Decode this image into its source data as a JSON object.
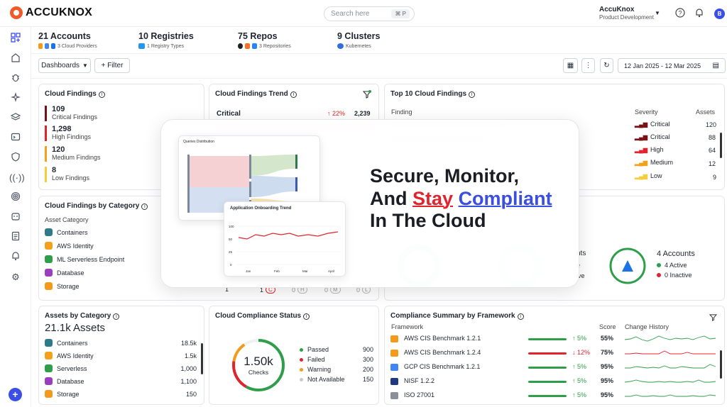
{
  "brand": {
    "name": "ACCUKNOX"
  },
  "search": {
    "placeholder": "Search here",
    "shortcut": "⌘ P"
  },
  "account": {
    "name": "AccuKnox",
    "workspace": "Product Development",
    "avatar_initial": "B"
  },
  "summary": {
    "accounts": {
      "title": "21 Accounts",
      "sub": "3 Cloud Providers"
    },
    "registries": {
      "title": "10 Registries",
      "sub": "1 Registry Types"
    },
    "repos": {
      "title": "75 Repos",
      "sub": "3 Repositories"
    },
    "clusters": {
      "title": "9 Clusters",
      "sub": "Kubernetes"
    }
  },
  "toolbar": {
    "dashboards_label": "Dashboards",
    "filter_label": "+ Filter",
    "date_range": "12 Jan 2025 - 12 Mar 2025"
  },
  "cloud_findings": {
    "title": "Cloud Findings",
    "rows": [
      {
        "value": "109",
        "label": "Critical Findings",
        "color": "#7a1016"
      },
      {
        "value": "1,298",
        "label": "High Findings",
        "color": "#e0242d"
      },
      {
        "value": "120",
        "label": "Medium Findings",
        "color": "#f2a11a"
      },
      {
        "value": "8",
        "label": "Low Findings",
        "color": "#f4cf3c"
      }
    ]
  },
  "trend": {
    "title": "Cloud Findings Trend",
    "row_label": "Critical",
    "change": "↑ 22%",
    "value": "2,239"
  },
  "top10": {
    "title": "Top 10 Cloud Findings",
    "col_finding": "Finding",
    "col_severity": "Severity",
    "col_assets": "Assets",
    "rows": [
      {
        "severity": "Critical",
        "assets": "120"
      },
      {
        "severity": "Critical",
        "assets": "88"
      },
      {
        "severity": "High",
        "assets": "64"
      },
      {
        "severity": "Medium",
        "assets": "12"
      },
      {
        "severity": "Low",
        "assets": "9"
      }
    ]
  },
  "by_category": {
    "title": "Cloud Findings by Category",
    "subtitle": "Asset Category",
    "items": [
      "Containers",
      "AWS Identity",
      "ML Serverless Endpoint",
      "Database",
      "Storage"
    ],
    "footer": {
      "n1": "1",
      "n2": "1",
      "c": "C",
      "h_pre": "0",
      "h": "H",
      "m_pre": "0",
      "m": "M",
      "l_pre": "0",
      "l": "L"
    }
  },
  "accounts_card": {
    "title": "4 Accounts",
    "active": "4 Active",
    "inactive": "0 Inactive",
    "partial1": "nts",
    "partial2": "e",
    "partial3": "ive"
  },
  "overlay": {
    "line1": "Secure, Monitor,",
    "line2_pre": "And ",
    "line2_red": "Stay",
    "line2_blue": "Compliant",
    "line3": "In The Cloud",
    "sankey_title": "Queries Distribution",
    "trend_title": "Application Onboarding Trend",
    "trend_y": [
      "100",
      "50",
      "25",
      "0"
    ],
    "trend_x": [
      "Jan",
      "Feb",
      "Mar",
      "April"
    ]
  },
  "assets": {
    "title": "Assets by Category",
    "total": "21.1k Assets",
    "items": [
      {
        "label": "Containers",
        "value": "18.5k"
      },
      {
        "label": "AWS Identity",
        "value": "1.5k"
      },
      {
        "label": "Serverless",
        "value": "1,000"
      },
      {
        "label": "Database",
        "value": "1,100"
      },
      {
        "label": "Storage",
        "value": "150"
      }
    ]
  },
  "compliance_status": {
    "title": "Cloud Compliance Status",
    "center_value": "1.50k",
    "center_label": "Checks",
    "legend": [
      {
        "label": "Passed",
        "value": "900",
        "color": "#2e9e4a"
      },
      {
        "label": "Failed",
        "value": "300",
        "color": "#e0242d"
      },
      {
        "label": "Warning",
        "value": "200",
        "color": "#f29a1a"
      },
      {
        "label": "Not Available",
        "value": "150",
        "color": "#c5cad3"
      }
    ]
  },
  "frameworks": {
    "title": "Compliance Summary by Framework",
    "col_framework": "Framework",
    "col_score": "Score",
    "col_history": "Change History",
    "rows": [
      {
        "name": "AWS CIS Benchmark 1.2.1",
        "change": "↑ 5%",
        "score": "55%",
        "trend_color": "#2e9e4a",
        "change_color": "#2e9e4a"
      },
      {
        "name": "AWS CIS Benchmark 1.2.4",
        "change": "↓ 12%",
        "score": "75%",
        "trend_color": "#e0242d",
        "change_color": "#e0242d"
      },
      {
        "name": "GCP CIS Benchmark 1.2.1",
        "change": "↑ 5%",
        "score": "95%",
        "trend_color": "#2e9e4a",
        "change_color": "#2e9e4a"
      },
      {
        "name": "NISF 1.2.2",
        "change": "↑ 5%",
        "score": "95%",
        "trend_color": "#2e9e4a",
        "change_color": "#2e9e4a"
      },
      {
        "name": "ISO 27001",
        "change": "↑ 5%",
        "score": "95%",
        "trend_color": "#2e9e4a",
        "change_color": "#2e9e4a"
      }
    ]
  }
}
